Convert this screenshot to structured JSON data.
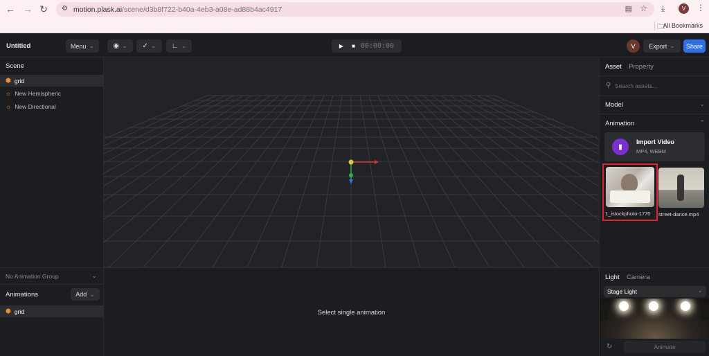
{
  "browser": {
    "url_main": "motion.plask.ai",
    "url_path": "/scene/d3b8f722-b40a-4eb3-a08e-ad88b4ac4917",
    "bookmarks_label": "All Bookmarks",
    "profile_initial": "V"
  },
  "toolbar": {
    "title": "Untitled",
    "menu_label": "Menu",
    "timecode": "00:00:00",
    "avatar_initial": "V",
    "export_label": "Export",
    "share_label": "Share"
  },
  "scene": {
    "title": "Scene",
    "items": [
      {
        "label": "grid",
        "icon": "cube-icon"
      },
      {
        "label": "New Hemispheric",
        "icon": "sun-icon"
      },
      {
        "label": "New Directional",
        "icon": "sun-icon"
      }
    ]
  },
  "right_panel": {
    "tabs": [
      "Asset",
      "Property"
    ],
    "search_placeholder": "Search assets...",
    "model_label": "Model",
    "animation_label": "Animation",
    "import_title": "Import Video",
    "import_sub": "MP4, WEBM",
    "assets": [
      {
        "name": "1_istockphoto-1770"
      },
      {
        "name": "street-dance.mp4"
      }
    ]
  },
  "bottom_left": {
    "group_label": "No Animation Group",
    "animations_label": "Animations",
    "add_label": "Add",
    "items": [
      {
        "label": "grid"
      }
    ]
  },
  "bottom_center": {
    "message": "Select single animation"
  },
  "bottom_right": {
    "tabs": [
      "Light",
      "Camera"
    ],
    "preset": "Stage Light",
    "animate_label": "Animate"
  },
  "colors": {
    "accent_blue": "#2f6fe8",
    "highlight_red": "#e0232b",
    "import_purple": "#7b2fd0"
  }
}
